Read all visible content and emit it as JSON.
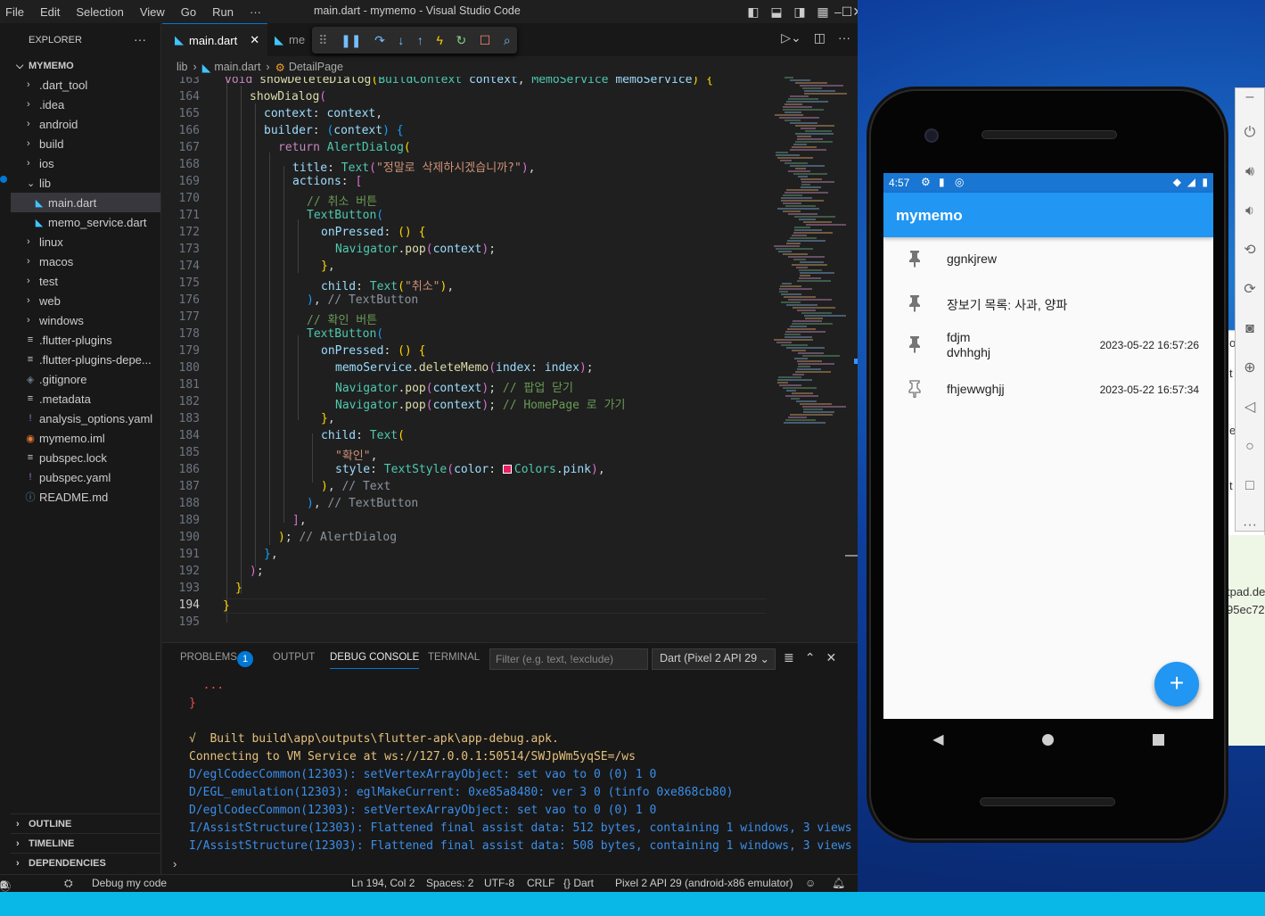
{
  "titlebar": {
    "menu": [
      "File",
      "Edit",
      "Selection",
      "View",
      "Go",
      "Run",
      "···"
    ],
    "title": "main.dart - mymemo - Visual Studio Code"
  },
  "explorer": {
    "header": "EXPLORER",
    "project": "MYMEMO",
    "items": [
      {
        "label": ".dart_tool",
        "type": "folder"
      },
      {
        "label": ".idea",
        "type": "folder"
      },
      {
        "label": "android",
        "type": "folder"
      },
      {
        "label": "build",
        "type": "folder"
      },
      {
        "label": "ios",
        "type": "folder"
      },
      {
        "label": "lib",
        "type": "folder-open"
      },
      {
        "label": "main.dart",
        "type": "dart",
        "selected": true
      },
      {
        "label": "memo_service.dart",
        "type": "dart"
      },
      {
        "label": "linux",
        "type": "folder"
      },
      {
        "label": "macos",
        "type": "folder"
      },
      {
        "label": "test",
        "type": "folder"
      },
      {
        "label": "web",
        "type": "folder"
      },
      {
        "label": "windows",
        "type": "folder"
      },
      {
        "label": ".flutter-plugins",
        "type": "file"
      },
      {
        "label": ".flutter-plugins-depe...",
        "type": "file"
      },
      {
        "label": ".gitignore",
        "type": "git"
      },
      {
        "label": ".metadata",
        "type": "file"
      },
      {
        "label": "analysis_options.yaml",
        "type": "yaml"
      },
      {
        "label": "mymemo.iml",
        "type": "rss"
      },
      {
        "label": "pubspec.lock",
        "type": "file"
      },
      {
        "label": "pubspec.yaml",
        "type": "yaml"
      },
      {
        "label": "README.md",
        "type": "info"
      }
    ],
    "sections": [
      "OUTLINE",
      "TIMELINE",
      "DEPENDENCIES"
    ]
  },
  "tabs": [
    {
      "label": "main.dart",
      "active": true
    },
    {
      "label": "me",
      "active": false
    }
  ],
  "breadcrumb": [
    "lib",
    "main.dart",
    "DetailPage"
  ],
  "code": {
    "line_numbers": [
      "163",
      "164",
      "165",
      "166",
      "167",
      "168",
      "169",
      "170",
      "171",
      "172",
      "173",
      "174",
      "175",
      "176",
      "177",
      "178",
      "179",
      "180",
      "181",
      "182",
      "183",
      "184",
      "185",
      "186",
      "187",
      "188",
      "189",
      "190",
      "191",
      "192",
      "193",
      "194",
      "195"
    ],
    "current_line": "194"
  },
  "panel": {
    "tabs": [
      "PROBLEMS",
      "OUTPUT",
      "DEBUG CONSOLE",
      "TERMINAL"
    ],
    "active_tab": "DEBUG CONSOLE",
    "problems_count": "1",
    "filter_placeholder": "Filter (e.g. text, !exclude)",
    "session": "Dart (Pixel 2 API 29",
    "console_lines": [
      {
        "text": "  ...",
        "color": "#f14c4c"
      },
      {
        "text": "}",
        "color": "#f14c4c"
      },
      {
        "text": "",
        "color": "#ccc"
      },
      {
        "text": "√  Built build\\app\\outputs\\flutter-apk\\app-debug.apk.",
        "color": "#e5c07b"
      },
      {
        "text": "Connecting to VM Service at ws://127.0.0.1:50514/SWJpWm5yqSE=/ws",
        "color": "#e5c07b"
      },
      {
        "text": "D/eglCodecCommon(12303): setVertexArrayObject: set vao to 0 (0) 1 0",
        "color": "#3b8eea"
      },
      {
        "text": "D/EGL_emulation(12303): eglMakeCurrent: 0xe85a8480: ver 3 0 (tinfo 0xe868cb80)",
        "color": "#3b8eea"
      },
      {
        "text": "D/eglCodecCommon(12303): setVertexArrayObject: set vao to 0 (0) 1 0",
        "color": "#3b8eea"
      },
      {
        "text": "I/AssistStructure(12303): Flattened final assist data: 512 bytes, containing 1 windows, 3 views",
        "color": "#3b8eea"
      },
      {
        "text": "I/AssistStructure(12303): Flattened final assist data: 508 bytes, containing 1 windows, 3 views",
        "color": "#3b8eea"
      }
    ]
  },
  "statusbar": {
    "errors": "0",
    "warnings": "0",
    "info": "1",
    "debug": "Debug my code",
    "position": "Ln 194, Col 2",
    "spaces": "Spaces: 2",
    "encoding": "UTF-8",
    "eol": "CRLF",
    "language": "{} Dart",
    "device": "Pixel 2 API 29 (android-x86 emulator)"
  },
  "phone": {
    "time": "4:57",
    "app_title": "mymemo",
    "memos": [
      {
        "title": "ggnkjrew",
        "subtitle": "",
        "date": "",
        "pinned": true
      },
      {
        "title": "장보기 목록: 사과, 양파",
        "subtitle": "",
        "date": "",
        "pinned": true
      },
      {
        "title": "fdjm",
        "subtitle": "dvhhghj",
        "date": "2023-05-22 16:57:26",
        "pinned": true
      },
      {
        "title": "fhjewwghjj",
        "subtitle": "",
        "date": "2023-05-22 16:57:34",
        "pinned": false
      }
    ],
    "fab": "+"
  },
  "background_text": [
    "tpad.de",
    "95ec72",
    "cs",
    "t",
    "o",
    "t",
    "e"
  ],
  "colors": {
    "accent": "#0078d4",
    "app_bar": "#2196f3",
    "taskbar": "#0ab8e8"
  }
}
